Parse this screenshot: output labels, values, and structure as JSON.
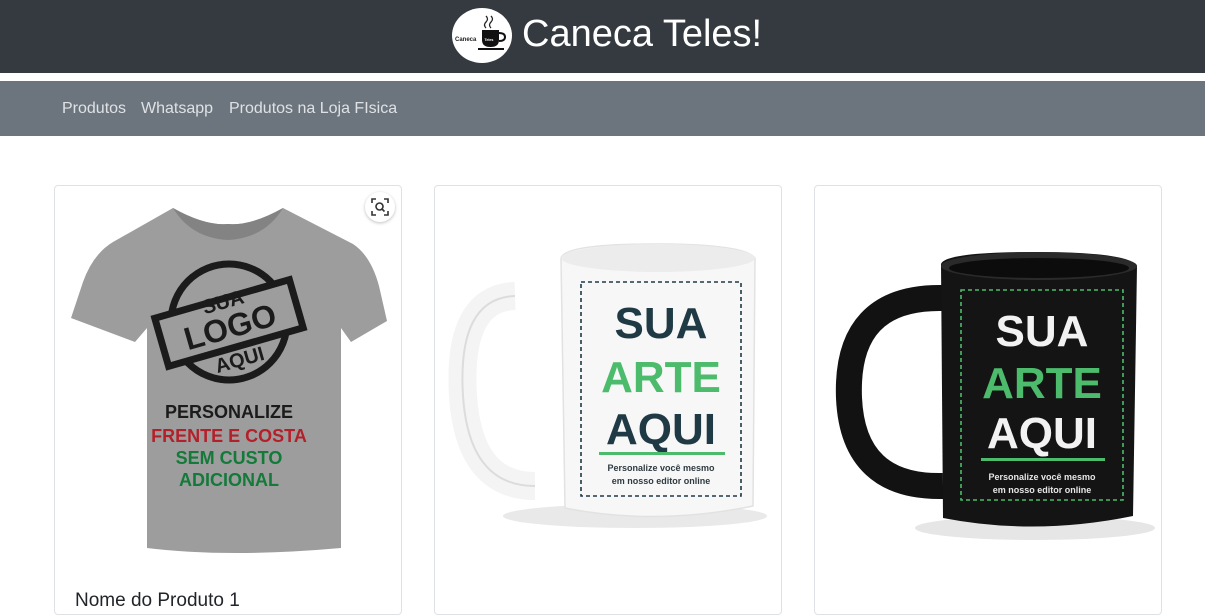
{
  "header": {
    "title": "Caneca Teles!",
    "logo_text": "Caneca",
    "logo_badge": "Teles"
  },
  "nav": {
    "items": [
      {
        "label": "Produtos"
      },
      {
        "label": "Whatsapp"
      },
      {
        "label": "Produtos na Loja FIsica"
      }
    ]
  },
  "products": [
    {
      "title": "Nome do Produto 1",
      "image": {
        "icon": "tshirt-icon",
        "lines": [
          "SUA",
          "LOGO",
          "AQUI",
          "PERSONALIZE",
          "FRENTE E COSTA",
          "SEM CUSTO",
          "ADICIONAL"
        ]
      },
      "zoom_icon": "zoom-scan-icon"
    },
    {
      "title": "",
      "image": {
        "icon": "white-mug-icon",
        "lines": [
          "SUA",
          "ARTE",
          "AQUI",
          "Personalize você mesmo",
          "em nosso editor online"
        ]
      }
    },
    {
      "title": "",
      "image": {
        "icon": "black-mug-icon",
        "lines": [
          "SUA",
          "ARTE",
          "AQUI",
          "Personalize você mesmo",
          "em nosso editor online"
        ]
      }
    }
  ],
  "colors": {
    "topbar": "#343a40",
    "navbar": "#6c757d",
    "nav_text": "#dfe2e5",
    "accent_green": "#4cbb6c",
    "dark_text": "#1f3a44",
    "red_text": "#b3202a",
    "green_text": "#137a3a"
  }
}
